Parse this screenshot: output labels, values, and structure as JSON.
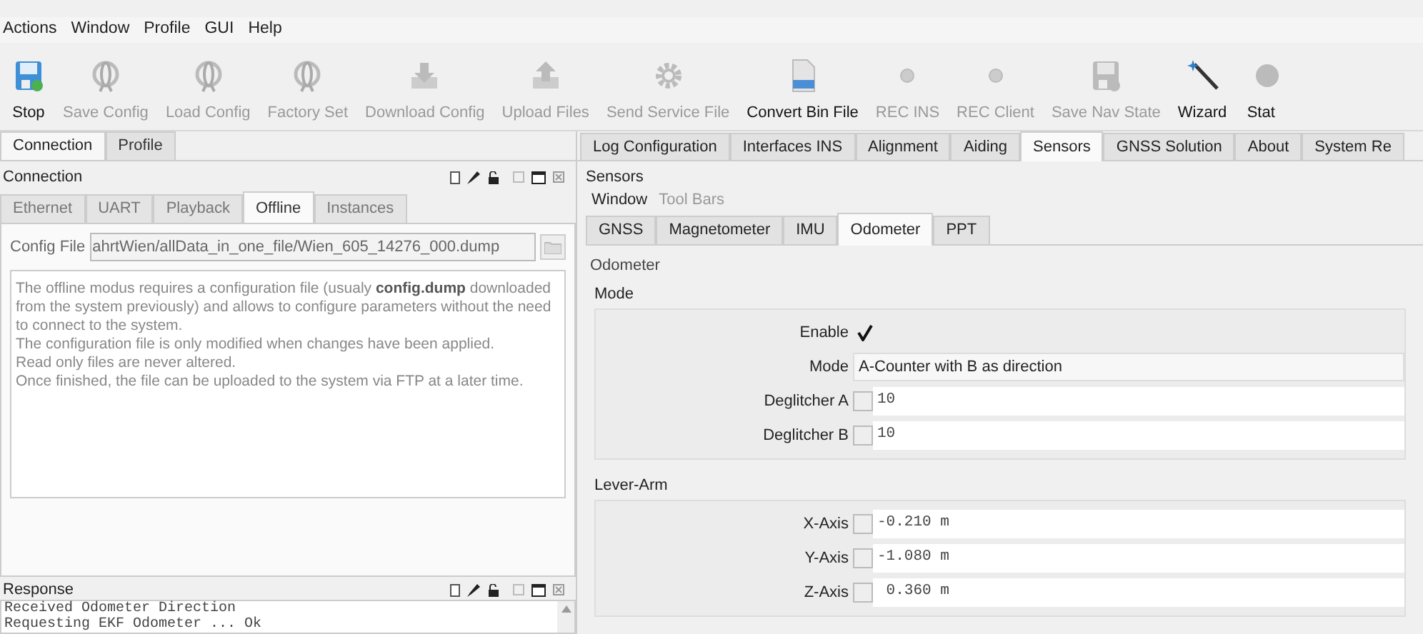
{
  "menu": [
    {
      "label": "Actions"
    },
    {
      "label": "Window"
    },
    {
      "label": "Profile"
    },
    {
      "label": "GUI"
    },
    {
      "label": "Help"
    }
  ],
  "toolbar": [
    {
      "label": "Stop",
      "kind": "floppy",
      "disabled": false
    },
    {
      "label": "Save Config",
      "kind": "gyro",
      "disabled": true
    },
    {
      "label": "Load Config",
      "kind": "gyro",
      "disabled": true
    },
    {
      "label": "Factory Set",
      "kind": "gyro",
      "disabled": true
    },
    {
      "label": "Download Config",
      "kind": "download",
      "disabled": true
    },
    {
      "label": "Upload Files",
      "kind": "upload",
      "disabled": true
    },
    {
      "label": "Send Service File",
      "kind": "gear",
      "disabled": true
    },
    {
      "label": "Convert Bin File",
      "kind": "binfile",
      "disabled": false
    },
    {
      "label": "REC INS",
      "kind": "dot",
      "disabled": true
    },
    {
      "label": "REC Client",
      "kind": "dot",
      "disabled": true
    },
    {
      "label": "Save Nav State",
      "kind": "floppy",
      "disabled": true
    },
    {
      "label": "Wizard",
      "kind": "wand",
      "disabled": false
    },
    {
      "label": "Stat",
      "kind": "circle",
      "disabled": false
    }
  ],
  "left_tabs": [
    {
      "label": "Connection",
      "selected": true
    },
    {
      "label": "Profile",
      "selected": false
    }
  ],
  "connection": {
    "title": "Connection",
    "tabs": [
      {
        "label": "Ethernet",
        "selected": false
      },
      {
        "label": "UART",
        "selected": false
      },
      {
        "label": "Playback",
        "selected": false
      },
      {
        "label": "Offline",
        "selected": true
      },
      {
        "label": "Instances",
        "selected": false
      }
    ],
    "config_file": {
      "label": "Config File",
      "value": "ahrtWien/allData_in_one_file/Wien_605_14276_000.dump"
    },
    "description": [
      "The offline modus requires a configuration file (usualy **config.dump** downloaded from the system previously) and allows to configure parameters without the need to connect to the system.",
      "The configuration file is only modified when changes have been applied.",
      "Read only files are never altered.",
      "Once finished, the file can be uploaded to the system via FTP at a later time."
    ]
  },
  "response": {
    "title": "Response",
    "lines": [
      "Received Odometer Direction",
      "Requesting EKF Odometer ... Ok"
    ]
  },
  "right_tabs": [
    {
      "label": "Log Configuration",
      "selected": false
    },
    {
      "label": "Interfaces INS",
      "selected": false
    },
    {
      "label": "Alignment",
      "selected": false
    },
    {
      "label": "Aiding",
      "selected": false
    },
    {
      "label": "Sensors",
      "selected": true
    },
    {
      "label": "GNSS Solution",
      "selected": false
    },
    {
      "label": "About",
      "selected": false
    },
    {
      "label": "System Re",
      "selected": false
    }
  ],
  "sensors": {
    "title": "Sensors",
    "menu": [
      {
        "label": "Window",
        "disabled": false
      },
      {
        "label": "Tool Bars",
        "disabled": true
      }
    ],
    "tabs": [
      {
        "label": "GNSS",
        "selected": false
      },
      {
        "label": "Magnetometer",
        "selected": false
      },
      {
        "label": "IMU",
        "selected": false
      },
      {
        "label": "Odometer",
        "selected": true
      },
      {
        "label": "PPT",
        "selected": false
      }
    ],
    "section": "Odometer",
    "groups": [
      {
        "title": "Mode",
        "rows": [
          {
            "kind": "checkbox",
            "label": "Enable",
            "checked": true
          },
          {
            "kind": "select",
            "label": "Mode",
            "value": "A-Counter with B as direction"
          },
          {
            "kind": "spin",
            "label": "Deglitcher A",
            "value": "10"
          },
          {
            "kind": "spin",
            "label": "Deglitcher B",
            "value": "10"
          }
        ]
      },
      {
        "title": "Lever-Arm",
        "rows": [
          {
            "kind": "spin",
            "label": "X-Axis",
            "value": "-0.210 m"
          },
          {
            "kind": "spin",
            "label": "Y-Axis",
            "value": "-1.080 m"
          },
          {
            "kind": "spin",
            "label": "Z-Axis",
            "value": " 0.360 m"
          }
        ]
      }
    ]
  }
}
